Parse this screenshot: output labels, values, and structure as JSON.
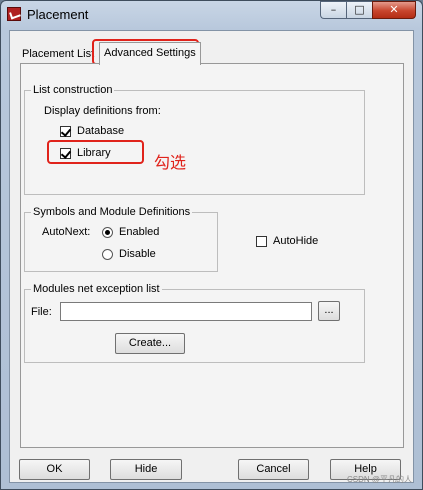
{
  "window": {
    "title": "Placement",
    "controls": {
      "minimize": "–",
      "maximize": "□",
      "close": "✕"
    }
  },
  "tabs": [
    {
      "label": "Placement List",
      "active": false
    },
    {
      "label": "Advanced Settings",
      "active": true
    }
  ],
  "list_construction": {
    "title": "List construction",
    "caption": "Display definitions from:",
    "database": {
      "label": "Database",
      "checked": true
    },
    "library": {
      "label": "Library",
      "checked": true
    }
  },
  "symbols": {
    "title": "Symbols and Module Definitions",
    "autonext_label": "AutoNext:",
    "enabled": {
      "label": "Enabled",
      "selected": true
    },
    "disable": {
      "label": "Disable",
      "selected": false
    }
  },
  "autohide": {
    "label": "AutoHide",
    "checked": false
  },
  "modules": {
    "title": "Modules net exception list",
    "file_label": "File:",
    "file_value": "",
    "browse_label": "...",
    "create_label": "Create..."
  },
  "footer": {
    "ok": "OK",
    "hide": "Hide",
    "cancel": "Cancel",
    "help": "Help"
  },
  "annotation": {
    "text": "勾选",
    "color": "#e0231b"
  },
  "watermark": "CSDN @平凡的人"
}
